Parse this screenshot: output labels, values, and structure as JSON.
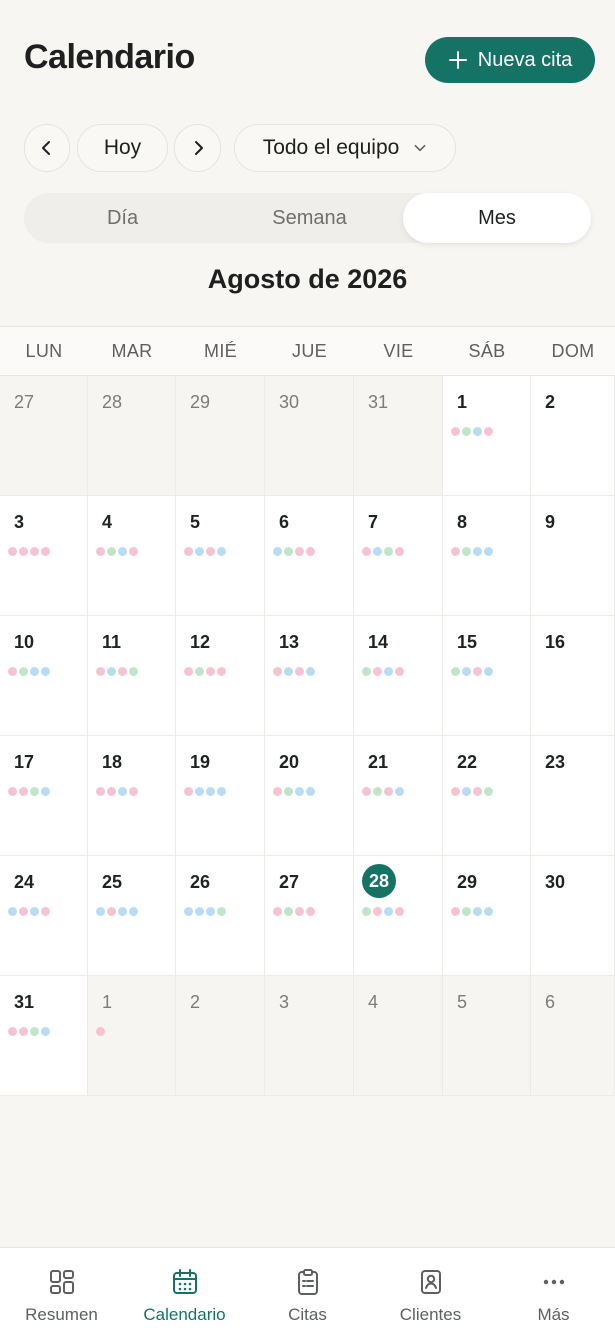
{
  "header": {
    "title": "Calendario",
    "new_button_label": "Nueva cita"
  },
  "toolbar": {
    "today_label": "Hoy",
    "team_filter_label": "Todo el equipo"
  },
  "view_switch": {
    "options": [
      "Día",
      "Semana",
      "Mes"
    ],
    "selected": "Mes"
  },
  "calendar": {
    "month_title": "Agosto de 2026",
    "weekdays": [
      "LUN",
      "MAR",
      "MIÉ",
      "JUE",
      "VIE",
      "SÁB",
      "DOM"
    ],
    "today": 28,
    "dot_colors": {
      "pink": "#f6c3d2",
      "green": "#bfe6c8",
      "blue": "#b8dcf5"
    },
    "weeks": [
      [
        {
          "day": "27",
          "outside": true,
          "dots": []
        },
        {
          "day": "28",
          "outside": true,
          "dots": []
        },
        {
          "day": "29",
          "outside": true,
          "dots": []
        },
        {
          "day": "30",
          "outside": true,
          "dots": []
        },
        {
          "day": "31",
          "outside": true,
          "dots": []
        },
        {
          "day": "1",
          "outside": false,
          "dots": [
            "pink",
            "green",
            "blue",
            "pink"
          ]
        },
        {
          "day": "2",
          "outside": false,
          "dots": []
        }
      ],
      [
        {
          "day": "3",
          "outside": false,
          "dots": [
            "pink",
            "pink",
            "pink",
            "pink"
          ]
        },
        {
          "day": "4",
          "outside": false,
          "dots": [
            "pink",
            "green",
            "blue",
            "pink"
          ]
        },
        {
          "day": "5",
          "outside": false,
          "dots": [
            "pink",
            "blue",
            "pink",
            "blue"
          ]
        },
        {
          "day": "6",
          "outside": false,
          "dots": [
            "blue",
            "green",
            "pink",
            "pink"
          ]
        },
        {
          "day": "7",
          "outside": false,
          "dots": [
            "pink",
            "blue",
            "green",
            "pink"
          ]
        },
        {
          "day": "8",
          "outside": false,
          "dots": [
            "pink",
            "green",
            "blue",
            "blue"
          ]
        },
        {
          "day": "9",
          "outside": false,
          "dots": []
        }
      ],
      [
        {
          "day": "10",
          "outside": false,
          "dots": [
            "pink",
            "green",
            "blue",
            "blue"
          ]
        },
        {
          "day": "11",
          "outside": false,
          "dots": [
            "pink",
            "blue",
            "pink",
            "green"
          ]
        },
        {
          "day": "12",
          "outside": false,
          "dots": [
            "pink",
            "green",
            "pink",
            "pink"
          ]
        },
        {
          "day": "13",
          "outside": false,
          "dots": [
            "pink",
            "blue",
            "pink",
            "blue"
          ]
        },
        {
          "day": "14",
          "outside": false,
          "dots": [
            "green",
            "pink",
            "blue",
            "pink"
          ]
        },
        {
          "day": "15",
          "outside": false,
          "dots": [
            "green",
            "blue",
            "pink",
            "blue"
          ]
        },
        {
          "day": "16",
          "outside": false,
          "dots": []
        }
      ],
      [
        {
          "day": "17",
          "outside": false,
          "dots": [
            "pink",
            "pink",
            "green",
            "blue"
          ]
        },
        {
          "day": "18",
          "outside": false,
          "dots": [
            "pink",
            "pink",
            "blue",
            "pink"
          ]
        },
        {
          "day": "19",
          "outside": false,
          "dots": [
            "pink",
            "blue",
            "blue",
            "blue"
          ]
        },
        {
          "day": "20",
          "outside": false,
          "dots": [
            "pink",
            "green",
            "blue",
            "blue"
          ]
        },
        {
          "day": "21",
          "outside": false,
          "dots": [
            "pink",
            "green",
            "pink",
            "blue"
          ]
        },
        {
          "day": "22",
          "outside": false,
          "dots": [
            "pink",
            "blue",
            "pink",
            "green"
          ]
        },
        {
          "day": "23",
          "outside": false,
          "dots": []
        }
      ],
      [
        {
          "day": "24",
          "outside": false,
          "dots": [
            "blue",
            "pink",
            "blue",
            "pink"
          ]
        },
        {
          "day": "25",
          "outside": false,
          "dots": [
            "blue",
            "pink",
            "blue",
            "blue"
          ]
        },
        {
          "day": "26",
          "outside": false,
          "dots": [
            "blue",
            "blue",
            "blue",
            "green"
          ]
        },
        {
          "day": "27",
          "outside": false,
          "dots": [
            "pink",
            "green",
            "pink",
            "pink"
          ]
        },
        {
          "day": "28",
          "outside": false,
          "dots": [
            "green",
            "pink",
            "blue",
            "pink"
          ]
        },
        {
          "day": "29",
          "outside": false,
          "dots": [
            "pink",
            "green",
            "blue",
            "blue"
          ]
        },
        {
          "day": "30",
          "outside": false,
          "dots": []
        }
      ],
      [
        {
          "day": "31",
          "outside": false,
          "dots": [
            "pink",
            "pink",
            "green",
            "blue"
          ]
        },
        {
          "day": "1",
          "outside": true,
          "dots": [
            "pink"
          ]
        },
        {
          "day": "2",
          "outside": true,
          "dots": []
        },
        {
          "day": "3",
          "outside": true,
          "dots": []
        },
        {
          "day": "4",
          "outside": true,
          "dots": []
        },
        {
          "day": "5",
          "outside": true,
          "dots": []
        },
        {
          "day": "6",
          "outside": true,
          "dots": []
        }
      ]
    ]
  },
  "bottom_nav": {
    "items": [
      {
        "label": "Resumen",
        "icon": "dashboard-icon"
      },
      {
        "label": "Calendario",
        "icon": "calendar-icon"
      },
      {
        "label": "Citas",
        "icon": "clipboard-icon"
      },
      {
        "label": "Clientes",
        "icon": "contacts-icon"
      },
      {
        "label": "Más",
        "icon": "more-icon"
      }
    ],
    "active": "Calendario"
  },
  "colors": {
    "accent": "#157366"
  }
}
